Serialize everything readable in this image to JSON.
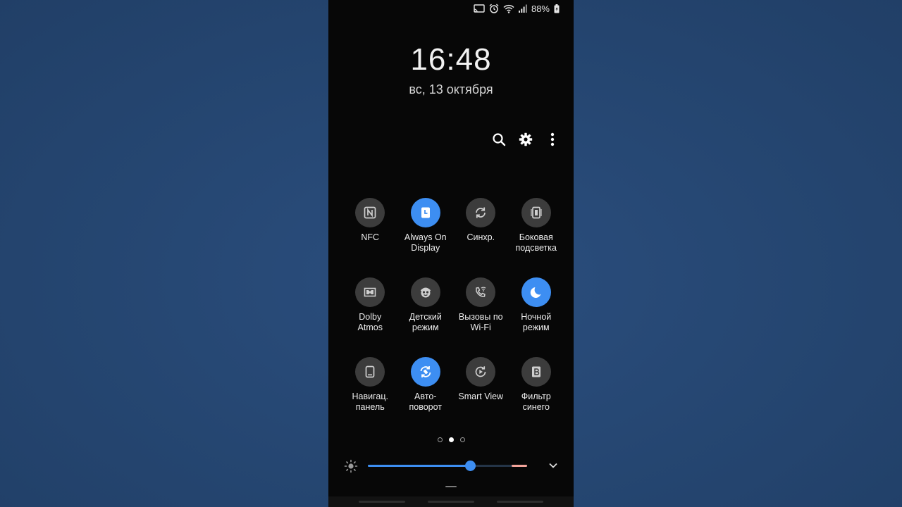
{
  "status_bar": {
    "battery_percent": "88%",
    "icons": [
      "cast-icon",
      "alarm-icon",
      "wifi-icon",
      "signal-icon",
      "battery-charging-icon"
    ]
  },
  "lock": {
    "time": "16:48",
    "date": "вс, 13 октября"
  },
  "header_icons": [
    "search-icon",
    "settings-gear-icon",
    "more-vertical-icon"
  ],
  "quick_tiles": [
    {
      "label": "NFC",
      "icon": "nfc-icon",
      "active": false
    },
    {
      "label": "Always On\nDisplay",
      "icon": "always-on-display-icon",
      "active": true
    },
    {
      "label": "Синхр.",
      "icon": "sync-icon",
      "active": false
    },
    {
      "label": "Боковая\nподсветка",
      "icon": "edge-lighting-icon",
      "active": false
    },
    {
      "label": "Dolby\nAtmos",
      "icon": "dolby-icon",
      "active": false
    },
    {
      "label": "Детский\nрежим",
      "icon": "kids-mode-icon",
      "active": false
    },
    {
      "label": "Вызовы по\nWi-Fi",
      "icon": "wifi-calling-icon",
      "active": false
    },
    {
      "label": "Ночной\nрежим",
      "icon": "night-mode-moon-icon",
      "active": true
    },
    {
      "label": "Навигац.\nпанель",
      "icon": "navigation-bar-icon",
      "active": false
    },
    {
      "label": "Авто-\nповорот",
      "icon": "auto-rotate-icon",
      "active": true
    },
    {
      "label": "Smart View",
      "icon": "smart-view-icon",
      "active": false
    },
    {
      "label": "Фильтр\nсинего",
      "icon": "blue-light-filter-icon",
      "active": false
    }
  ],
  "pagination": {
    "total": 3,
    "current": 2
  },
  "brightness": {
    "level": 0.64,
    "icon": "brightness-sun-icon",
    "expand_icon": "chevron-down-icon"
  },
  "colors": {
    "accent": "#3d8ef2",
    "tile_inactive": "#3c3c3c",
    "panel_bg": "#070707",
    "wallpaper": "#264773"
  }
}
